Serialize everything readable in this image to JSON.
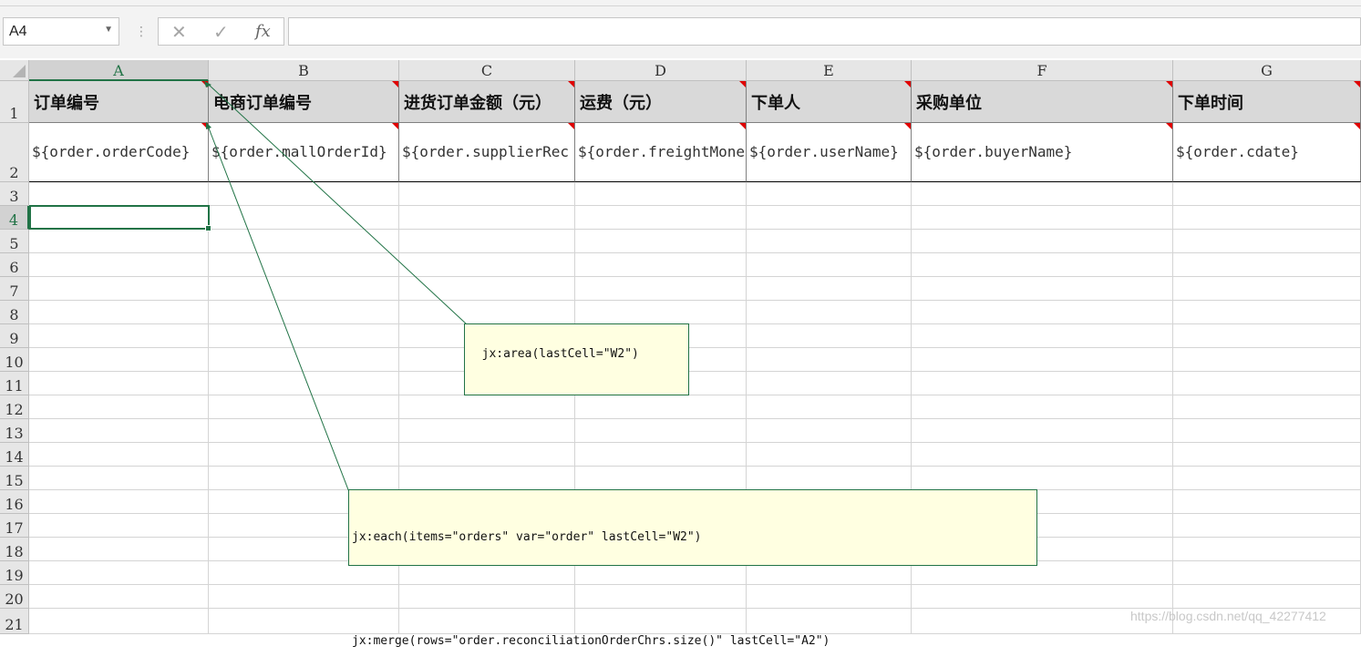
{
  "formula_bar": {
    "name_box": "A4",
    "cancel_glyph": "✕",
    "enter_glyph": "✓",
    "fx_label": "fx",
    "formula_value": ""
  },
  "columns": [
    "A",
    "B",
    "C",
    "D",
    "E",
    "F",
    "G"
  ],
  "selected_column": "A",
  "rows": [
    "1",
    "2",
    "3",
    "4",
    "5",
    "6",
    "7",
    "8",
    "9",
    "10",
    "11",
    "12",
    "13",
    "14",
    "15",
    "16",
    "17",
    "18",
    "19",
    "20",
    "21"
  ],
  "selected_row": "4",
  "header_row": [
    "订单编号",
    "电商订单编号",
    "进货订单金额（元）",
    "运费（元）",
    "下单人",
    "采购单位",
    "下单时间"
  ],
  "template_row": [
    "${order.orderCode}",
    "${order.mallOrderId}",
    "${order.supplierRec",
    "${order.freightMone",
    "${order.userName}",
    "${order.buyerName}",
    "${order.cdate}"
  ],
  "comments": {
    "area": "jx:area(lastCell=\"W2\")",
    "each": "jx:each(items=\"orders\" var=\"order\" lastCell=\"W2\")",
    "merge": "jx:merge(rows=\"order.reconciliationOrderChrs.size()\" lastCell=\"A2\")"
  },
  "accent_color": "#217346",
  "comment_bg": "#ffffe1",
  "watermark": "https://blog.csdn.net/qq_42277412"
}
